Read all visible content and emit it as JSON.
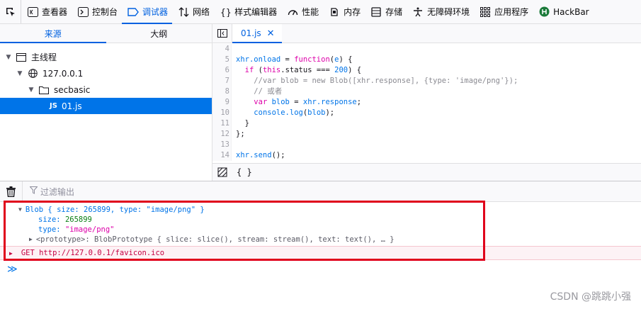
{
  "toolbar": {
    "tabs": [
      {
        "label": "查看器",
        "icon": "inspector-icon",
        "active": false
      },
      {
        "label": "控制台",
        "icon": "console-icon",
        "active": false
      },
      {
        "label": "调试器",
        "icon": "debugger-icon",
        "active": true
      },
      {
        "label": "网络",
        "icon": "network-icon",
        "active": false
      },
      {
        "label": "样式编辑器",
        "icon": "style-editor-icon",
        "active": false
      },
      {
        "label": "性能",
        "icon": "performance-icon",
        "active": false
      },
      {
        "label": "内存",
        "icon": "memory-icon",
        "active": false
      },
      {
        "label": "存储",
        "icon": "storage-icon",
        "active": false
      },
      {
        "label": "无障碍环境",
        "icon": "accessibility-icon",
        "active": false
      },
      {
        "label": "应用程序",
        "icon": "application-icon",
        "active": false
      },
      {
        "label": "HackBar",
        "icon": "hackbar-icon",
        "active": false
      }
    ]
  },
  "sources": {
    "tabs": [
      "来源",
      "大纲"
    ],
    "tree": {
      "thread": "主线程",
      "host": "127.0.0.1",
      "folder": "secbasic",
      "file_badge": "JS",
      "file": "01.js"
    }
  },
  "editor": {
    "tab_label": "01.js",
    "lines": [
      {
        "n": "4",
        "html": ""
      },
      {
        "n": "5",
        "html": "<span class=\"fn\">xhr.onload</span> <span class=\"pl\">=</span> <span class=\"kw\">function</span><span class=\"pl\">(</span><span class=\"fn\">e</span><span class=\"pl\">) {</span>"
      },
      {
        "n": "6",
        "html": "  <span class=\"kw\">if</span> <span class=\"pl\">(</span><span class=\"kw\">this</span><span class=\"pl\">.status === </span><span class=\"nm\">200</span><span class=\"pl\">) {</span>"
      },
      {
        "n": "7",
        "html": "    <span class=\"cm\">//var blob = new Blob([xhr.response], {type: 'image/png'});</span>"
      },
      {
        "n": "8",
        "html": "    <span class=\"cm\">// 或者</span>"
      },
      {
        "n": "9",
        "html": "    <span class=\"kw\">var</span> <span class=\"fn\">blob</span> <span class=\"pl\">=</span> <span class=\"fn\">xhr.response</span><span class=\"pl\">;</span>"
      },
      {
        "n": "10",
        "html": "    <span class=\"fn\">console.log</span><span class=\"pl\">(</span><span class=\"fn\">blob</span><span class=\"pl\">);</span>"
      },
      {
        "n": "11",
        "html": "  <span class=\"pl\">}</span>"
      },
      {
        "n": "12",
        "html": "<span class=\"pl\">};</span>"
      },
      {
        "n": "13",
        "html": ""
      },
      {
        "n": "14",
        "html": "<span class=\"fn\">xhr.send</span><span class=\"pl\">();</span>"
      }
    ],
    "footer_pretty": "{ }"
  },
  "console": {
    "filter_placeholder": "过滤输出",
    "blob_header": "Blob { size: 265899, type: \"image/png\" }",
    "size_key": "size",
    "size_value": "265899",
    "type_key": "type",
    "type_value": "\"image/png\"",
    "prototype_key": "<prototype>",
    "prototype_value": "BlobPrototype { slice: slice(), stream: stream(), text: text(), … }",
    "error_text": "GET http://127.0.0.1/favicon.ico",
    "prompt": "≫"
  },
  "watermark": "CSDN @跳跳小强",
  "colors": {
    "accent": "#0061e0",
    "highlight_box": "#e0001b",
    "selection": "#0074e8"
  }
}
